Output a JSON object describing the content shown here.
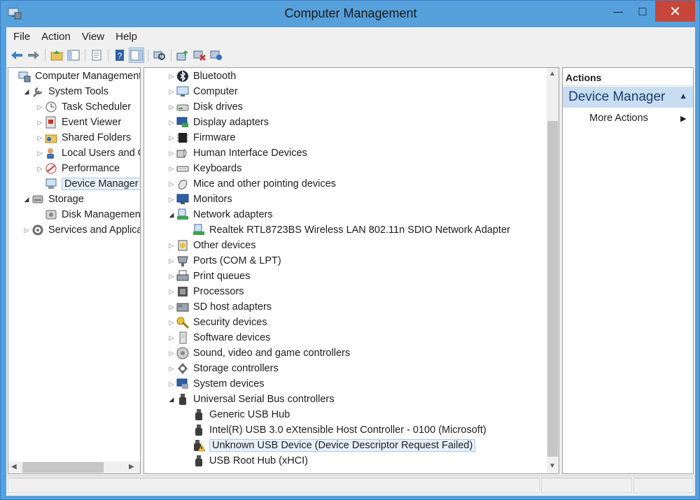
{
  "window": {
    "title": "Computer Management",
    "close_glyph": "✕",
    "max_glyph": "□",
    "min_glyph": "—"
  },
  "menu": [
    "File",
    "Action",
    "View",
    "Help"
  ],
  "left_tree": [
    {
      "label": "Computer Management",
      "level": 0,
      "expander": "",
      "icon": "computer-management-icon"
    },
    {
      "label": "System Tools",
      "level": 1,
      "expander": "open",
      "icon": "system-tools-icon"
    },
    {
      "label": "Task Scheduler",
      "level": 2,
      "expander": "closed",
      "icon": "task-scheduler-icon"
    },
    {
      "label": "Event Viewer",
      "level": 2,
      "expander": "closed",
      "icon": "event-viewer-icon"
    },
    {
      "label": "Shared Folders",
      "level": 2,
      "expander": "closed",
      "icon": "shared-folders-icon"
    },
    {
      "label": "Local Users and Gr",
      "level": 2,
      "expander": "closed",
      "icon": "local-users-icon"
    },
    {
      "label": "Performance",
      "level": 2,
      "expander": "closed",
      "icon": "performance-icon"
    },
    {
      "label": "Device Manager",
      "level": 2,
      "expander": "",
      "icon": "device-manager-icon",
      "selected": true
    },
    {
      "label": "Storage",
      "level": 1,
      "expander": "open",
      "icon": "storage-icon"
    },
    {
      "label": "Disk Management",
      "level": 2,
      "expander": "",
      "icon": "disk-management-icon"
    },
    {
      "label": "Services and Applicat",
      "level": 1,
      "expander": "closed",
      "icon": "services-icon"
    }
  ],
  "device_tree": [
    {
      "label": "Bluetooth",
      "level": 0,
      "expander": "closed",
      "icon": "bluetooth-icon"
    },
    {
      "label": "Computer",
      "level": 0,
      "expander": "closed",
      "icon": "computer-icon"
    },
    {
      "label": "Disk drives",
      "level": 0,
      "expander": "closed",
      "icon": "disk-drive-icon"
    },
    {
      "label": "Display adapters",
      "level": 0,
      "expander": "closed",
      "icon": "display-adapter-icon"
    },
    {
      "label": "Firmware",
      "level": 0,
      "expander": "closed",
      "icon": "firmware-icon"
    },
    {
      "label": "Human Interface Devices",
      "level": 0,
      "expander": "closed",
      "icon": "hid-icon"
    },
    {
      "label": "Keyboards",
      "level": 0,
      "expander": "closed",
      "icon": "keyboard-icon"
    },
    {
      "label": "Mice and other pointing devices",
      "level": 0,
      "expander": "closed",
      "icon": "mouse-icon"
    },
    {
      "label": "Monitors",
      "level": 0,
      "expander": "closed",
      "icon": "monitor-icon"
    },
    {
      "label": "Network adapters",
      "level": 0,
      "expander": "open",
      "icon": "network-adapter-icon"
    },
    {
      "label": "Realtek RTL8723BS Wireless LAN 802.11n SDIO Network Adapter",
      "level": 1,
      "expander": "",
      "icon": "network-adapter-icon"
    },
    {
      "label": "Other devices",
      "level": 0,
      "expander": "closed",
      "icon": "other-devices-icon"
    },
    {
      "label": "Ports (COM & LPT)",
      "level": 0,
      "expander": "closed",
      "icon": "port-icon"
    },
    {
      "label": "Print queues",
      "level": 0,
      "expander": "closed",
      "icon": "printer-icon"
    },
    {
      "label": "Processors",
      "level": 0,
      "expander": "closed",
      "icon": "processor-icon"
    },
    {
      "label": "SD host adapters",
      "level": 0,
      "expander": "closed",
      "icon": "sd-adapter-icon"
    },
    {
      "label": "Security devices",
      "level": 0,
      "expander": "closed",
      "icon": "security-icon"
    },
    {
      "label": "Software devices",
      "level": 0,
      "expander": "closed",
      "icon": "software-device-icon"
    },
    {
      "label": "Sound, video and game controllers",
      "level": 0,
      "expander": "closed",
      "icon": "sound-icon"
    },
    {
      "label": "Storage controllers",
      "level": 0,
      "expander": "closed",
      "icon": "storage-controller-icon"
    },
    {
      "label": "System devices",
      "level": 0,
      "expander": "closed",
      "icon": "system-device-icon"
    },
    {
      "label": "Universal Serial Bus controllers",
      "level": 0,
      "expander": "open",
      "icon": "usb-icon"
    },
    {
      "label": "Generic USB Hub",
      "level": 1,
      "expander": "",
      "icon": "usb-icon"
    },
    {
      "label": "Intel(R) USB 3.0 eXtensible Host Controller - 0100 (Microsoft)",
      "level": 1,
      "expander": "",
      "icon": "usb-icon"
    },
    {
      "label": "Unknown USB Device (Device Descriptor Request Failed)",
      "level": 1,
      "expander": "",
      "icon": "usb-warning-icon",
      "selected": true
    },
    {
      "label": "USB Root Hub (xHCI)",
      "level": 1,
      "expander": "",
      "icon": "usb-icon"
    }
  ],
  "actions": {
    "header": "Actions",
    "section": "Device Manager",
    "more": "More Actions"
  }
}
